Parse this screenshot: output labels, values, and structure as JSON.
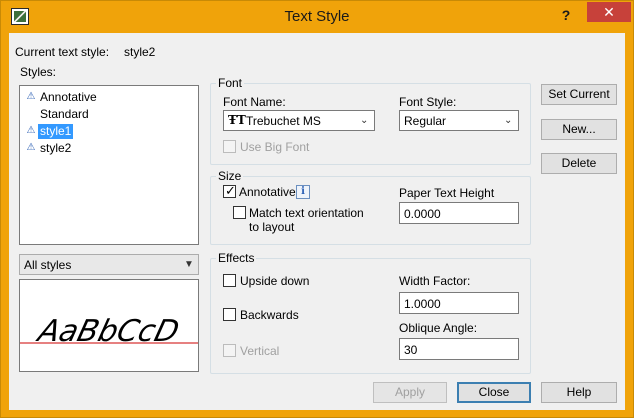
{
  "window": {
    "title": "Text Style",
    "help_glyph": "?",
    "close_glyph": "✕"
  },
  "current_style": {
    "label": "Current text style:",
    "value": "style2"
  },
  "styles": {
    "label": "Styles:",
    "items": [
      {
        "label": "Annotative",
        "annotative": true,
        "selected": false
      },
      {
        "label": "Standard",
        "annotative": false,
        "selected": false
      },
      {
        "label": "style1",
        "annotative": true,
        "selected": true
      },
      {
        "label": "style2",
        "annotative": true,
        "selected": false
      }
    ],
    "filter_value": "All styles"
  },
  "preview": {
    "text": "AaBbCcD"
  },
  "font": {
    "group_title": "Font",
    "name_label": "Font Name:",
    "name_value": "Trebuchet MS",
    "name_icon": "truetype-font-icon",
    "style_label": "Font Style:",
    "style_value": "Regular",
    "big_font_label": "Use Big Font"
  },
  "size": {
    "group_title": "Size",
    "annotative_label": "Annotative",
    "annotative_checked": true,
    "match_label_line1": "Match text orientation",
    "match_label_line2": "to layout",
    "paper_height_label": "Paper Text Height",
    "paper_height_value": "0.0000"
  },
  "effects": {
    "group_title": "Effects",
    "upside_down_label": "Upside down",
    "backwards_label": "Backwards",
    "vertical_label": "Vertical",
    "width_factor_label": "Width Factor:",
    "width_factor_value": "1.0000",
    "oblique_label": "Oblique Angle:",
    "oblique_value": "30"
  },
  "buttons": {
    "set_current": "Set Current",
    "new": "New...",
    "delete": "Delete",
    "apply": "Apply",
    "close": "Close",
    "help": "Help"
  },
  "colors": {
    "titlebar": "#f0a30a",
    "selection": "#3399ff",
    "close_button": "#c7413a",
    "preview_baseline": "#cc0000"
  }
}
